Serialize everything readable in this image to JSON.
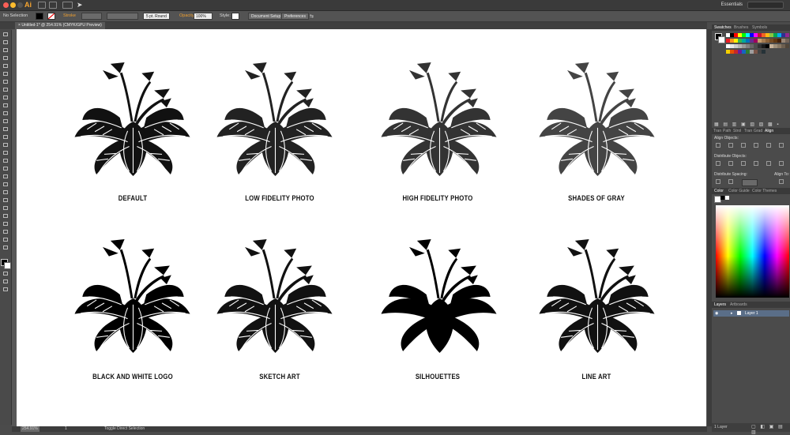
{
  "titlebar": {
    "app_logo": "Ai",
    "workspace": "Essentials"
  },
  "control_bar": {
    "selection": "No Selection",
    "stroke_label": "Stroke",
    "brush": "5 pt. Round",
    "opacity_label": "Opacity:",
    "opacity_value": "100%",
    "style_label": "Style:",
    "document_setup": "Document Setup",
    "preferences": "Preferences"
  },
  "document": {
    "tab_title": "Untitled-1* @ 254.91% (CMYK/GPU Preview)"
  },
  "artboard": {
    "captions": [
      "DEFAULT",
      "LOW FIDELITY PHOTO",
      "HIGH FIDELITY PHOTO",
      "SHADES OF GRAY",
      "BLACK AND WHITE LOGO",
      "SKETCH ART",
      "SILHOUETTES",
      "LINE ART"
    ]
  },
  "status": {
    "zoom": "254.91%",
    "page": "1",
    "tool": "Toggle Direct Selection"
  },
  "panels": {
    "swatches_tabs": [
      "Swatches",
      "Brushes",
      "Symbols"
    ],
    "align_tabs": [
      "Tran",
      "Path",
      "Strol",
      "Tran",
      "Grad",
      "Align"
    ],
    "align_objects": "Align Objects:",
    "distribute_objects": "Distribute Objects:",
    "distribute_spacing": "Distribute Spacing:",
    "align_to": "Align To:",
    "color_tabs": [
      "Color",
      "Color Guide",
      "Color Themes"
    ],
    "layers_tabs": [
      "Layers",
      "Artboards"
    ],
    "layer_name": "Layer 1",
    "layers_count": "1 Layer"
  },
  "colors": {
    "accent_orange": "#f0a030",
    "panel_bg": "#4b4b4b",
    "artboard": "#ffffff",
    "selected_layer": "#5a6e88"
  }
}
